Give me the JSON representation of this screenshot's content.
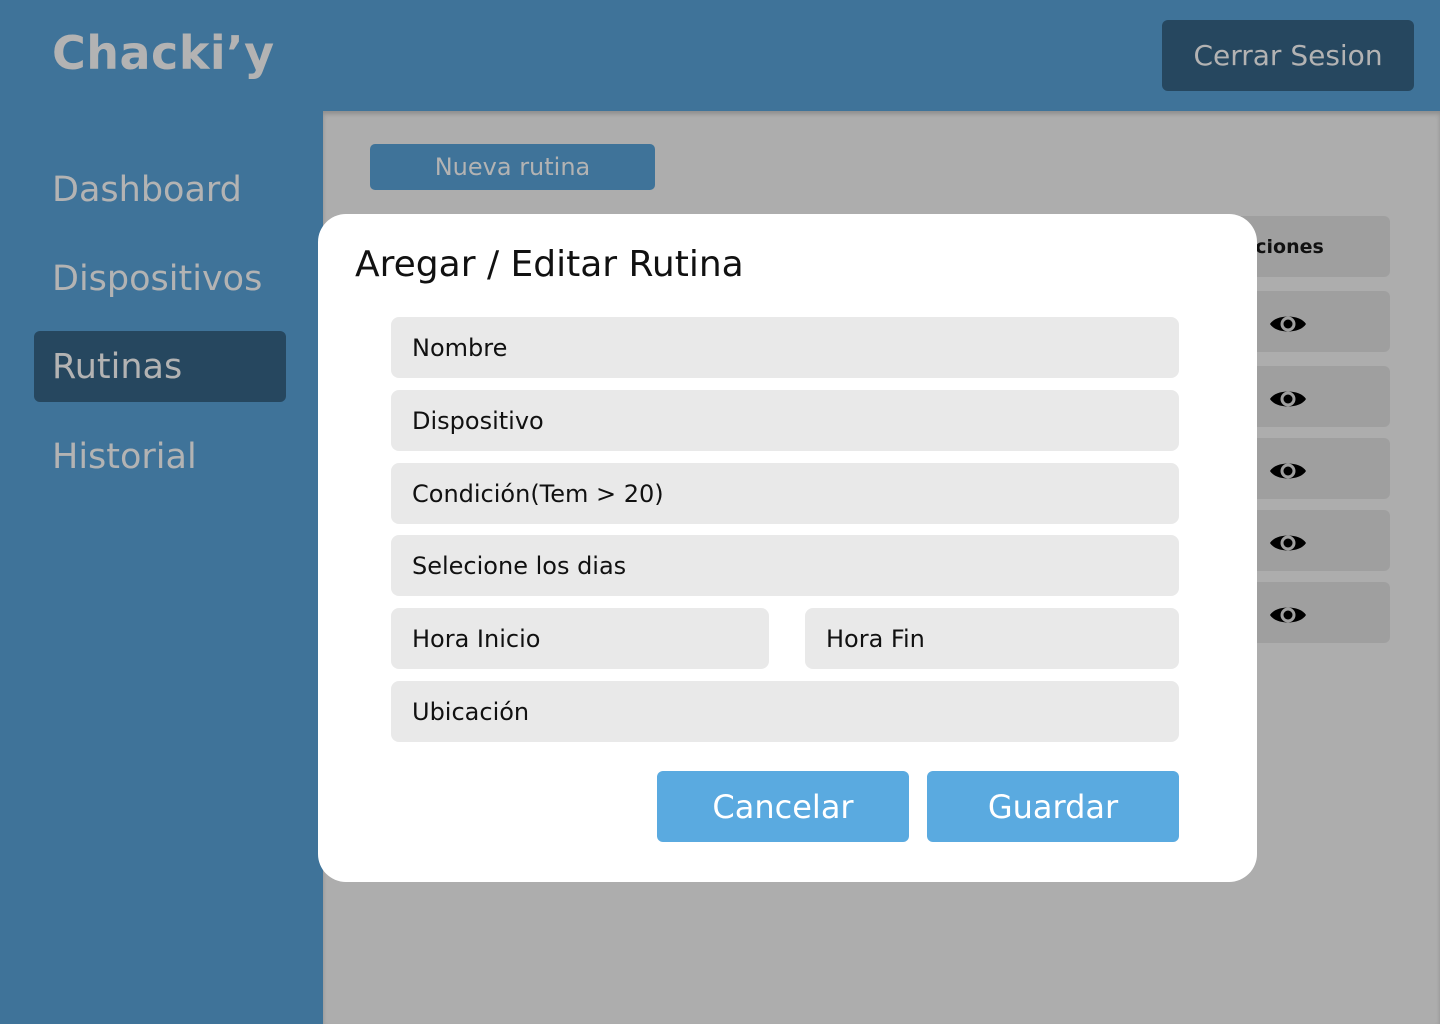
{
  "app": {
    "logo": "Chacki’y"
  },
  "header": {
    "logout_label": "Cerrar Sesion"
  },
  "sidebar": {
    "items": [
      {
        "label": "Dashboard",
        "active": false
      },
      {
        "label": "Dispositivos",
        "active": false
      },
      {
        "label": "Rutinas",
        "active": true
      },
      {
        "label": "Historial",
        "active": false
      }
    ]
  },
  "main": {
    "new_button_label": "Nueva rutina",
    "table": {
      "actions_header": "Acciones",
      "actions_header_visible": "cciones",
      "row_icons": [
        "eye-icon",
        "eye-icon",
        "eye-icon",
        "eye-icon",
        "eye-icon"
      ]
    }
  },
  "modal": {
    "title": "Aregar / Editar Rutina",
    "fields": {
      "nombre": "Nombre",
      "dispositivo": "Dispositivo",
      "condicion": "Condición(Tem > 20)",
      "dias": "Selecione los dias",
      "hora_inicio": "Hora Inicio",
      "hora_fin": "Hora Fin",
      "ubicacion": "Ubicación"
    },
    "cancel_label": "Cancelar",
    "save_label": "Guardar"
  },
  "colors": {
    "primary": "#3f7399",
    "primary_dark": "#26475f",
    "muted_text": "#b3b3b3",
    "overlay_bg": "#adadad",
    "button_accent": "#5aaae0",
    "field_bg": "#e9e9e9"
  }
}
